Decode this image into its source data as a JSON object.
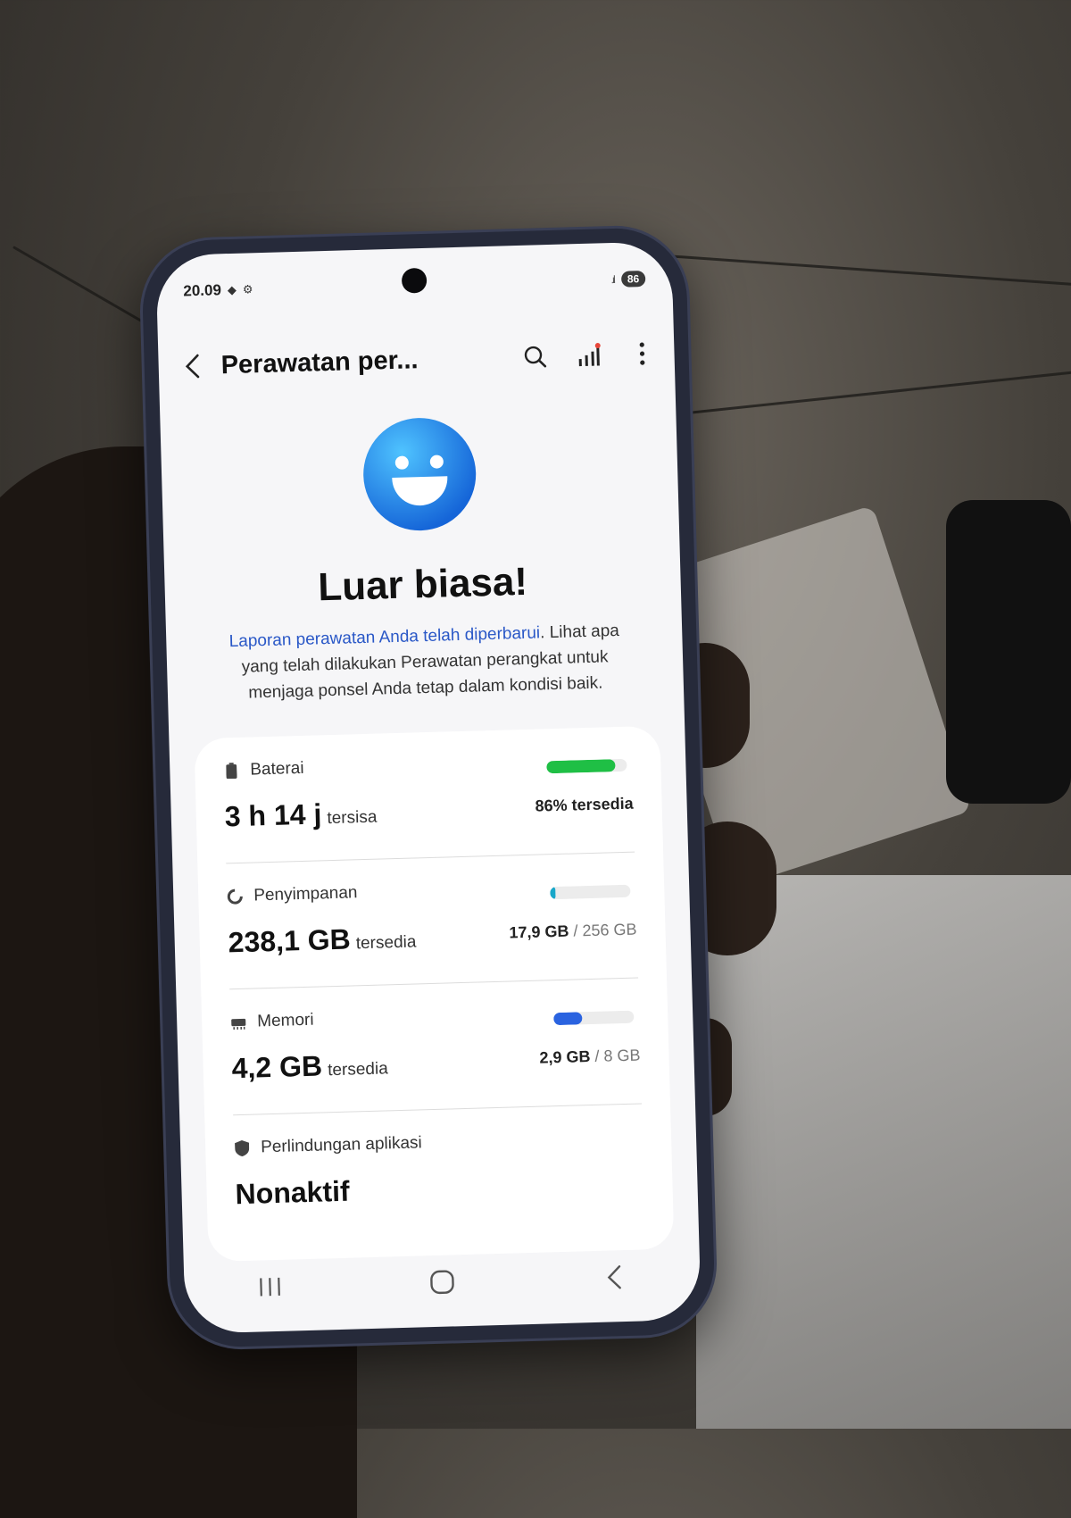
{
  "status_bar": {
    "time": "20.09",
    "battery_percent": "86"
  },
  "appbar": {
    "title": "Perawatan per...",
    "actions": [
      "search-icon",
      "stats-icon",
      "more-options-icon"
    ]
  },
  "hero": {
    "headline": "Luar biasa!",
    "description_link": "Laporan perawatan Anda telah diperbarui",
    "description_rest": ". Lihat apa yang telah dilakukan Perawatan perangkat untuk menjaga ponsel Anda tetap dalam kondisi baik."
  },
  "battery": {
    "label": "Baterai",
    "value": "3 h 14 j",
    "unit": "tersisa",
    "right_text": "86% tersedia",
    "level_percent": 86,
    "color": "#1fbf45"
  },
  "storage": {
    "label": "Penyimpanan",
    "value": "238,1 GB",
    "unit": "tersedia",
    "used": "17,9 GB",
    "total": "/ 256 GB",
    "level_percent": 7,
    "color": "#19a7c9"
  },
  "memory": {
    "label": "Memori",
    "value": "4,2 GB",
    "unit": "tersedia",
    "used": "2,9 GB",
    "total": "/ 8 GB",
    "level_percent": 36,
    "color": "#2a63e0"
  },
  "app_protection": {
    "label": "Perlindungan aplikasi",
    "value": "Nonaktif"
  },
  "navbar": [
    "recents-icon",
    "home-icon",
    "back-icon"
  ]
}
